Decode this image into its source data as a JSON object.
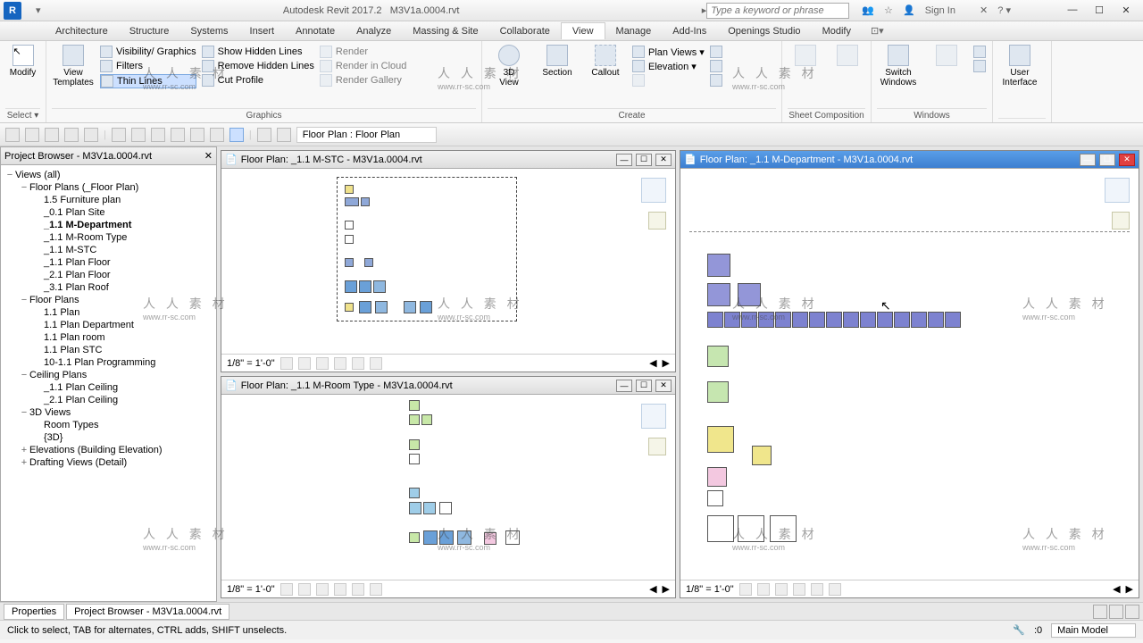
{
  "title": {
    "app": "Autodesk Revit 2017.2",
    "file": "M3V1a.0004.rvt"
  },
  "search_placeholder": "Type a keyword or phrase",
  "signin": "Sign In",
  "tabs": [
    "Architecture",
    "Structure",
    "Systems",
    "Insert",
    "Annotate",
    "Analyze",
    "Massing & Site",
    "Collaborate",
    "View",
    "Manage",
    "Add-Ins",
    "Openings Studio",
    "Modify"
  ],
  "active_tab": "View",
  "ribbon": {
    "select_panel": {
      "modify": "Modify",
      "label": "Select ▾"
    },
    "graphics": {
      "view_templates": "View\nTemplates",
      "visibility": "Visibility/ Graphics",
      "filters": "Filters",
      "thin_lines": "Thin  Lines",
      "show_hidden": "Show  Hidden Lines",
      "remove_hidden": "Remove  Hidden Lines",
      "cut_profile": "Cut  Profile",
      "render": "Render",
      "render_cloud": "Render  in Cloud",
      "render_gallery": "Render  Gallery",
      "label": "Graphics"
    },
    "create": {
      "threed": "3D\nView",
      "section": "Section",
      "callout": "Callout",
      "plan_views": "Plan  Views  ▾",
      "elevation": "Elevation  ▾",
      "label": "Create"
    },
    "sheet": {
      "label": "Sheet Composition"
    },
    "windows": {
      "switch": "Switch\nWindows",
      "user_interface": "User\nInterface",
      "label": "Windows"
    }
  },
  "qa": {
    "view_selector": "Floor Plan :  Floor Plan"
  },
  "browser": {
    "title": "Project Browser - M3V1a.0004.rvt",
    "items": [
      {
        "t": "Views (all)",
        "l": 0,
        "e": "−"
      },
      {
        "t": "Floor Plans (_Floor Plan)",
        "l": 1,
        "e": "−"
      },
      {
        "t": "1.5 Furniture plan",
        "l": 2
      },
      {
        "t": "_0.1 Plan Site",
        "l": 2
      },
      {
        "t": "_1.1 M-Department",
        "l": 2,
        "a": true
      },
      {
        "t": "_1.1 M-Room Type",
        "l": 2
      },
      {
        "t": "_1.1 M-STC",
        "l": 2
      },
      {
        "t": "_1.1 Plan Floor",
        "l": 2
      },
      {
        "t": "_2.1 Plan Floor",
        "l": 2
      },
      {
        "t": "_3.1 Plan Roof",
        "l": 2
      },
      {
        "t": "Floor Plans",
        "l": 1,
        "e": "−"
      },
      {
        "t": "1.1 Plan",
        "l": 2
      },
      {
        "t": "1.1 Plan Department",
        "l": 2
      },
      {
        "t": "1.1 Plan room",
        "l": 2
      },
      {
        "t": "1.1 Plan STC",
        "l": 2
      },
      {
        "t": "10-1.1 Plan Programming",
        "l": 2
      },
      {
        "t": "Ceiling Plans",
        "l": 1,
        "e": "−"
      },
      {
        "t": "_1.1 Plan Ceiling",
        "l": 2
      },
      {
        "t": "_2.1 Plan Ceiling",
        "l": 2
      },
      {
        "t": "3D Views",
        "l": 1,
        "e": "−"
      },
      {
        "t": "Room Types",
        "l": 2
      },
      {
        "t": "{3D}",
        "l": 2
      },
      {
        "t": "Elevations (Building Elevation)",
        "l": 1,
        "e": "+"
      },
      {
        "t": "Drafting Views (Detail)",
        "l": 1,
        "e": "+"
      }
    ]
  },
  "windows": {
    "w1": {
      "title": "Floor Plan: _1.1 M-STC - M3V1a.0004.rvt",
      "scale": "1/8\" = 1'-0\""
    },
    "w2": {
      "title": "Floor Plan: _1.1 M-Room Type - M3V1a.0004.rvt",
      "scale": "1/8\" = 1'-0\""
    },
    "w3": {
      "title": "Floor Plan: _1.1 M-Department - M3V1a.0004.rvt",
      "scale": "1/8\" = 1'-0\""
    }
  },
  "bottom_tabs": {
    "properties": "Properties",
    "browser": "Project Browser - M3V1a.0004.rvt"
  },
  "status": {
    "hint": "Click to select, TAB for alternates, CTRL adds, SHIFT unselects.",
    "model": "Main Model",
    "zero": ":0"
  },
  "watermark": {
    "cn": "人 人 素 材",
    "en": "www.rr-sc.com"
  }
}
